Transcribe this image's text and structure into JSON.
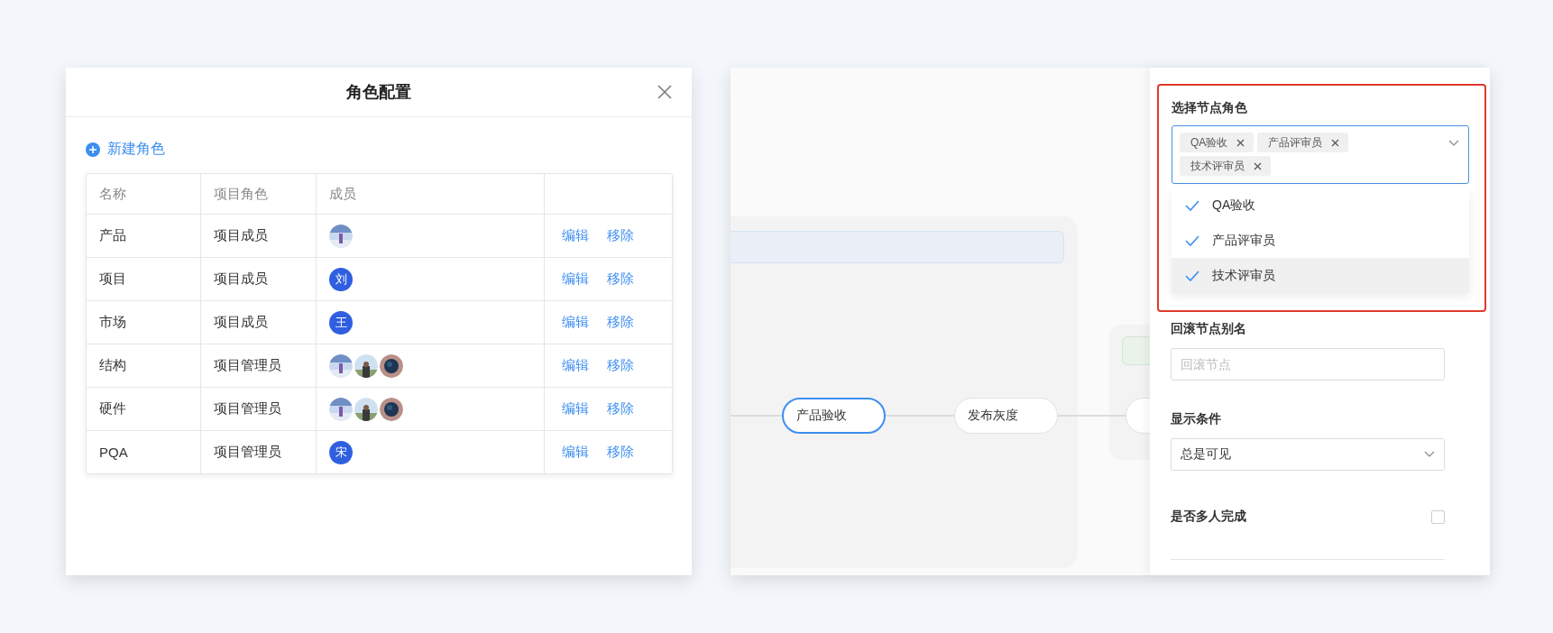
{
  "dialog": {
    "title": "角色配置",
    "new_role_link": "新建角色",
    "table": {
      "columns": [
        "名称",
        "项目角色",
        "成员"
      ],
      "rows": [
        {
          "name": "产品",
          "role": "项目成员",
          "members": [
            {
              "kind": "picture"
            }
          ],
          "actions": [
            "编辑",
            "移除"
          ]
        },
        {
          "name": "项目",
          "role": "项目成员",
          "members": [
            {
              "kind": "letter",
              "text": "刘"
            }
          ],
          "actions": [
            "编辑",
            "移除"
          ]
        },
        {
          "name": "市场",
          "role": "项目成员",
          "members": [
            {
              "kind": "letter",
              "text": "王"
            }
          ],
          "actions": [
            "编辑",
            "移除"
          ]
        },
        {
          "name": "结构",
          "role": "项目管理员",
          "members": [
            {
              "kind": "picture"
            },
            {
              "kind": "picture"
            },
            {
              "kind": "picture"
            }
          ],
          "actions": [
            "编辑",
            "移除"
          ]
        },
        {
          "name": "硬件",
          "role": "项目管理员",
          "members": [
            {
              "kind": "picture"
            },
            {
              "kind": "picture"
            },
            {
              "kind": "picture"
            }
          ],
          "actions": [
            "编辑",
            "移除"
          ]
        },
        {
          "name": "PQA",
          "role": "项目管理员",
          "members": [
            {
              "kind": "letter",
              "text": "宋"
            }
          ],
          "actions": [
            "编辑",
            "移除"
          ]
        }
      ]
    }
  },
  "flow": {
    "nodes": [
      {
        "label": "产品验收",
        "selected": true
      },
      {
        "label": "发布灰度",
        "selected": false
      }
    ]
  },
  "properties": {
    "role_field": {
      "label": "选择节点角色",
      "tags": [
        "QA验收",
        "产品评审员",
        "技术评审员"
      ]
    },
    "role_options": [
      {
        "label": "QA验收",
        "checked": true,
        "selected": false
      },
      {
        "label": "产品评审员",
        "checked": true,
        "selected": false
      },
      {
        "label": "技术评审员",
        "checked": true,
        "selected": true
      }
    ],
    "alias_field": {
      "label": "回滚节点别名",
      "placeholder": "回滚节点"
    },
    "condition_field": {
      "label": "显示条件",
      "value": "总是可见"
    },
    "multi_person": {
      "label": "是否多人完成",
      "checked": false
    }
  }
}
